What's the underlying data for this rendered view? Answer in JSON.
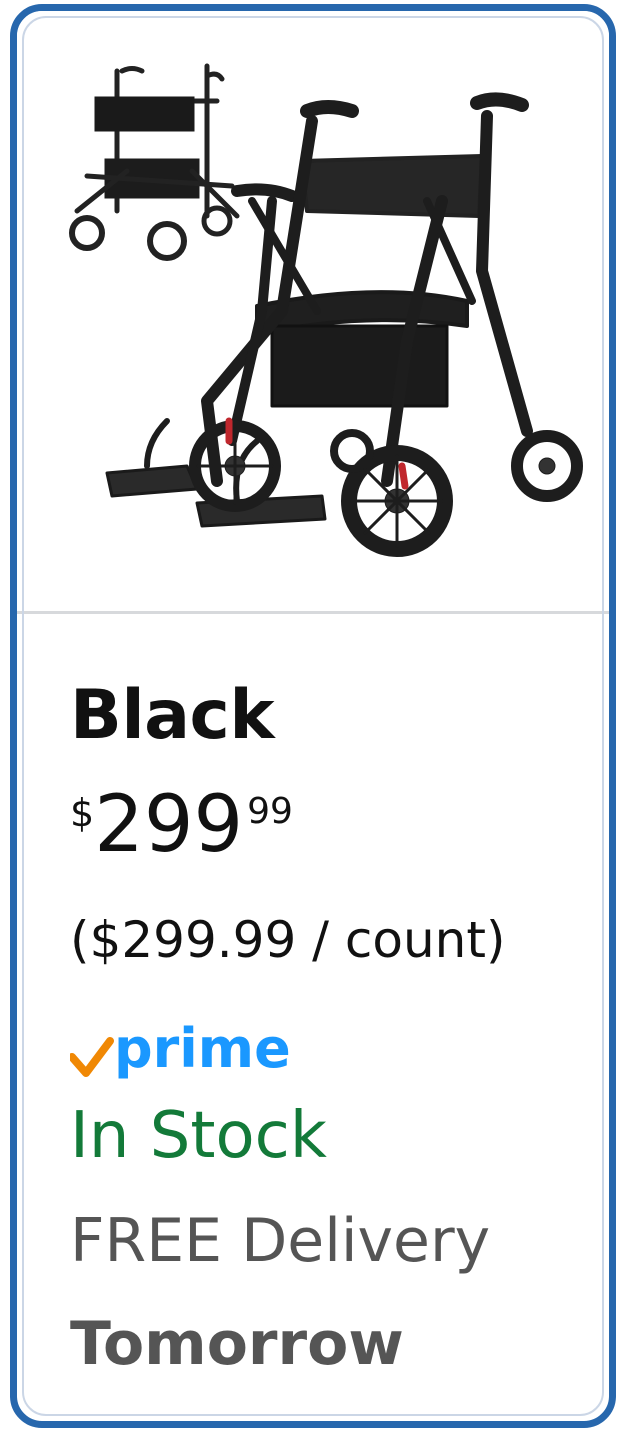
{
  "product": {
    "image_alt": "black rollator walker with seat and footrests",
    "color_name": "Black",
    "price": {
      "symbol": "$",
      "whole": "299",
      "fraction": "99"
    },
    "unit_price": "($299.99 / count)",
    "prime": {
      "label": "prime",
      "check_color": "#f08804",
      "text_color": "#1a98ff"
    },
    "availability": "In Stock",
    "delivery": {
      "label": "FREE Delivery",
      "when": "Tomorrow"
    }
  },
  "colors": {
    "card_border": "#2767ad",
    "in_stock": "#137a39",
    "muted_text": "#555555"
  }
}
